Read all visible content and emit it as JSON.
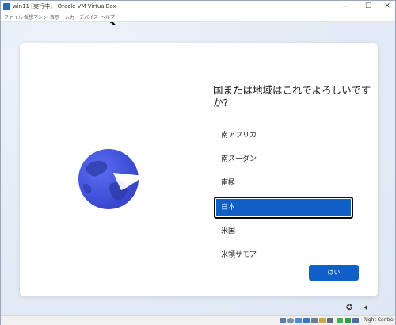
{
  "window": {
    "title": "win11 [実行中] - Oracle VM VirtualBox",
    "minimize_glyph": "—",
    "maximize_glyph": "☐",
    "close_glyph": "✕"
  },
  "menu": [
    "ファイル",
    "仮想マシン",
    "表示",
    "入力",
    "デバイス",
    "ヘルプ"
  ],
  "oobe": {
    "heading": "国または地域はこれでよろしいですか?",
    "countries": [
      "南アフリカ",
      "南スーダン",
      "南極",
      "日本",
      "米国",
      "米領サモア"
    ],
    "selected": "日本",
    "yes_label": "はい"
  },
  "tray": {
    "accessibility_icon": "accessibility-icon",
    "volume_icon": "volume-icon"
  },
  "statusbar": {
    "host_key_label": "Right Control",
    "icons": [
      "hard-disk-icon",
      "optical-drive-icon",
      "audio-icon",
      "network-icon",
      "usb-icon",
      "shared-folder-icon",
      "display-icon",
      "recording-icon",
      "cpu-icon",
      "arrow-icon"
    ]
  }
}
